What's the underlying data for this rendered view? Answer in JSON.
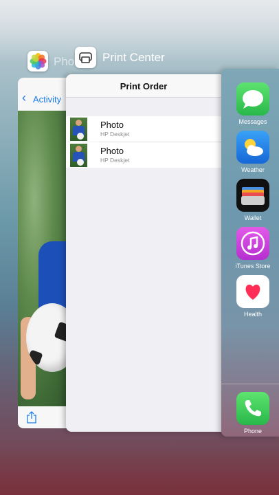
{
  "photos_app": {
    "title": "Pho",
    "back_label": "Activity"
  },
  "print_center": {
    "app_title": "Print Center",
    "nav_title": "Print Order",
    "jobs": [
      {
        "name": "Photo",
        "printer": "HP Deskjet"
      },
      {
        "name": "Photo",
        "printer": "HP Deskjet"
      }
    ]
  },
  "apps": [
    {
      "label": "Messages",
      "icon": "messages-icon",
      "color": "#35c759"
    },
    {
      "label": "Weather",
      "icon": "weather-icon",
      "color": "#1f8ff0"
    },
    {
      "label": "Wallet",
      "icon": "wallet-icon",
      "color": "#111111"
    },
    {
      "label": "iTunes Store",
      "icon": "itunes-store-icon",
      "color": "#d13cd9"
    },
    {
      "label": "Health",
      "icon": "health-icon",
      "color": "#ff2d55"
    },
    {
      "label": "Phone",
      "icon": "phone-icon",
      "color": "#35c759"
    }
  ]
}
